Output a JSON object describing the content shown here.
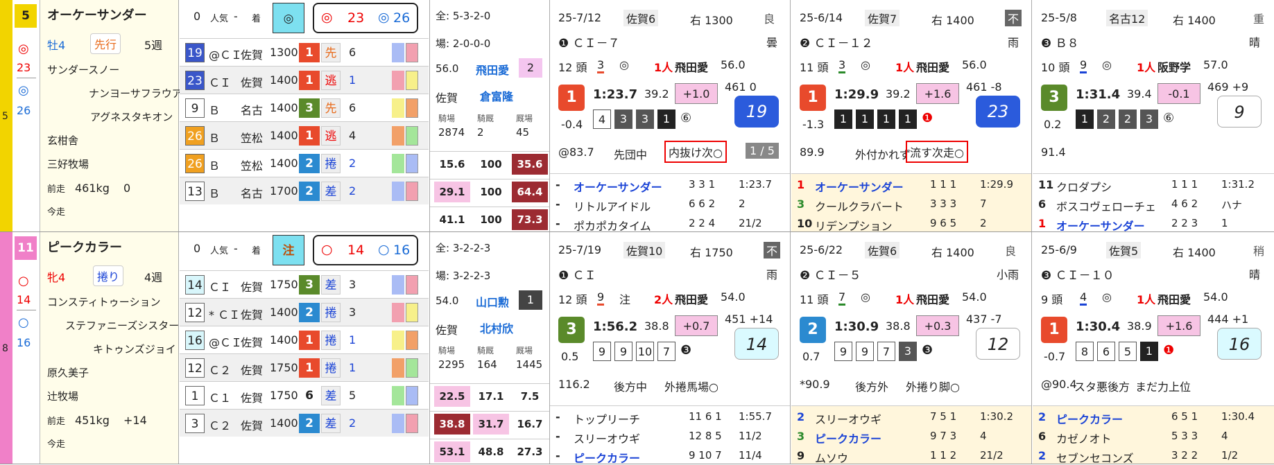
{
  "horses": [
    {
      "gate": "5",
      "num": "5",
      "gate_color": "#f2d400",
      "mark_top": "◎",
      "mark_top_value": "23",
      "mark_bottom": "◎",
      "mark_bottom_value": "26",
      "name": "オーケーサンダー",
      "sex_age": "牡4",
      "style": "先行",
      "interval": "5週",
      "sire": "サンダースノー",
      "dam": "ナンヨーサフラウア",
      "damsire": "アグネスタキオン",
      "owner": "玄柑舎",
      "breeder": "三好牧場",
      "prev_label": "前走",
      "weight": "461kg",
      "weight_diff": "0",
      "today_label": "今走",
      "odds_header": {
        "zero": "0",
        "ninki": "人気",
        "dash": "-",
        "chaku": "着",
        "mark": "◎",
        "mark1": "◎",
        "v1": "23",
        "mark2": "◎",
        "v2": "26"
      },
      "past": [
        {
          "rank": "19",
          "rank_color": "#3a56c9",
          "cls": "@ＣＩ",
          "track": "佐賀",
          "dist": "1300",
          "finish": "1",
          "fin_color": "#e84a2c",
          "style": "先",
          "fld": "6"
        },
        {
          "rank": "23",
          "rank_color": "#3a56c9",
          "cls": "ＣＩ",
          "track": "佐賀",
          "dist": "1400",
          "finish": "1",
          "fin_color": "#e84a2c",
          "style": "逃",
          "fld": "1"
        },
        {
          "rank": "9",
          "rank_color": "#ffffff",
          "cls": "Ｂ",
          "track": "名古",
          "dist": "1400",
          "finish": "3",
          "fin_color": "#5a8a2a",
          "style": "先",
          "fld": "6"
        },
        {
          "rank": "26",
          "rank_color": "#f0a020",
          "cls": "Ｂ",
          "track": "笠松",
          "dist": "1400",
          "finish": "1",
          "fin_color": "#e84a2c",
          "style": "逃",
          "fld": "4"
        },
        {
          "rank": "26",
          "rank_color": "#f0a020",
          "cls": "Ｂ",
          "track": "笠松",
          "dist": "1400",
          "finish": "2",
          "fin_color": "#2b8ad0",
          "style": "捲",
          "fld": "2"
        },
        {
          "rank": "13",
          "rank_color": "#ffffff",
          "cls": "Ｂ",
          "track": "名古",
          "dist": "1700",
          "finish": "2",
          "fin_color": "#2b8ad0",
          "style": "差",
          "fld": "2"
        }
      ],
      "stats": {
        "all": "全: 5-3-2-0",
        "course": "場: 2-0-0-0",
        "jockey_weight": "56.0",
        "jockey": "飛田愛",
        "jockey_num": "2",
        "trainer_loc": "佐賀",
        "trainer": "倉富隆",
        "head": [
          "騎場",
          "騎厩",
          "厩場"
        ],
        "counts": [
          "2874",
          "2",
          "45"
        ],
        "rows": [
          [
            "15.6",
            "100",
            "35.6"
          ],
          [
            "29.1",
            "100",
            "64.4"
          ],
          [
            "41.1",
            "100",
            "73.3"
          ]
        ]
      },
      "races": [
        {
          "date": "25-7/12",
          "track": "佐賀6",
          "dist": "右 1300",
          "cond": "良",
          "weather": "曇",
          "cls": "❶ ＣＩ－７",
          "heads": "12 頭",
          "num": "3",
          "mark": "◎",
          "ninki": "1人",
          "jockey": "飛田愛",
          "jw": "56.0",
          "finish": "1",
          "fin_color": "#e84a2c",
          "time": "1:23.7",
          "last": "39.2",
          "diff": "+1.0",
          "bw": "461 0",
          "idx": "19",
          "idx_style": "blue",
          "margin": "-0.4",
          "pos": [
            "4",
            "3",
            "3",
            "1"
          ],
          "pos_end": "⑥",
          "pace": "@83.7",
          "note1": "先団中",
          "note2": "内抜け次○",
          "box_note": "1 / 5",
          "res": [
            [
              "-",
              "オーケーサンダー",
              "3 3 1",
              "1:23.7"
            ],
            [
              "-",
              "リトルアイドル",
              "6 6 2",
              "2"
            ],
            [
              "-",
              "ポカポカタイム",
              "2 2 4",
              "21/2"
            ]
          ]
        },
        {
          "date": "25-6/14",
          "track": "佐賀7",
          "dist": "右 1400",
          "cond": "不",
          "weather": "雨",
          "cls": "❷ ＣＩ－１２",
          "heads": "11 頭",
          "num": "3",
          "mark": "◎",
          "ninki": "1人",
          "jockey": "飛田愛",
          "jw": "56.0",
          "finish": "1",
          "fin_color": "#e84a2c",
          "time": "1:29.9",
          "last": "39.2",
          "diff": "+1.6",
          "bw": "461 -8",
          "idx": "23",
          "idx_style": "blue",
          "margin": "-1.3",
          "pos": [
            "1",
            "1",
            "1",
            "1"
          ],
          "pos_end": "❶",
          "pace": "89.9",
          "note1": "外付かれず",
          "note2": "流す次走○",
          "box_note": "",
          "res": [
            [
              "1",
              "オーケーサンダー",
              "1 1 1",
              "1:29.9"
            ],
            [
              "3",
              "クールクラバート",
              "3 3 3",
              "7"
            ],
            [
              "10",
              "リデンプション",
              "9 6 5",
              "2"
            ]
          ]
        },
        {
          "date": "25-5/8",
          "track": "名古12",
          "dist": "右 1400",
          "cond": "重",
          "weather": "晴",
          "cls": "❸ Ｂ８",
          "heads": "10 頭",
          "num": "9",
          "mark": "◎",
          "ninki": "1人",
          "jockey": "阪野学",
          "jw": "57.0",
          "finish": "3",
          "fin_color": "#5a8a2a",
          "time": "1:31.4",
          "last": "39.4",
          "diff": "-0.1",
          "bw": "469 +9",
          "idx": "9",
          "idx_style": "white",
          "margin": "0.2",
          "pos": [
            "1",
            "2",
            "2",
            "3"
          ],
          "pos_end": "⑥",
          "pace": "91.4",
          "note1": "",
          "note2": "",
          "box_note": "",
          "res": [
            [
              "11",
              "クロダプシ",
              "1 1 1",
              "1:31.2"
            ],
            [
              "6",
              "ボスコヴェローチェ",
              "4 6 2",
              "ハナ"
            ],
            [
              "1",
              "オーケーサンダー",
              "2 2 3",
              "1"
            ]
          ]
        }
      ]
    },
    {
      "gate": "8",
      "num": "11",
      "gate_color": "#f080c8",
      "mark_top": "○",
      "mark_top_value": "14",
      "mark_bottom": "○",
      "mark_bottom_value": "16",
      "name": "ピークカラー",
      "sex_age": "牝4",
      "style": "捲り",
      "interval": "4週",
      "sire": "コンスティトゥーション",
      "dam": "ステファニーズシスター",
      "damsire": "キトゥンズジョイ",
      "owner": "原久美子",
      "breeder": "辻牧場",
      "prev_label": "前走",
      "weight": "451kg",
      "weight_diff": "+14",
      "today_label": "今走",
      "odds_header": {
        "zero": "0",
        "ninki": "人気",
        "dash": "-",
        "chaku": "着",
        "mark": "注",
        "mark1": "○",
        "v1": "14",
        "mark2": "○",
        "v2": "16"
      },
      "past": [
        {
          "rank": "14",
          "rank_color": "#d8f6fb",
          "cls": "ＣＩ",
          "track": "佐賀",
          "dist": "1750",
          "finish": "3",
          "fin_color": "#5a8a2a",
          "style": "差",
          "fld": "3"
        },
        {
          "rank": "12",
          "rank_color": "#ffffff",
          "cls": "* ＣＩ",
          "track": "佐賀",
          "dist": "1400",
          "finish": "2",
          "fin_color": "#2b8ad0",
          "style": "捲",
          "fld": "3"
        },
        {
          "rank": "16",
          "rank_color": "#d8f6fb",
          "cls": "@ＣＩ",
          "track": "佐賀",
          "dist": "1400",
          "finish": "1",
          "fin_color": "#e84a2c",
          "style": "捲",
          "fld": "1"
        },
        {
          "rank": "12",
          "rank_color": "#ffffff",
          "cls": "Ｃ２",
          "track": "佐賀",
          "dist": "1750",
          "finish": "1",
          "fin_color": "#e84a2c",
          "style": "捲",
          "fld": "1"
        },
        {
          "rank": "1",
          "rank_color": "#ffffff",
          "cls": "Ｃ１",
          "track": "佐賀",
          "dist": "1750",
          "finish": "6",
          "fin_color": "#ffffff",
          "style": "差",
          "fld": "5"
        },
        {
          "rank": "3",
          "rank_color": "#ffffff",
          "cls": "Ｃ２",
          "track": "佐賀",
          "dist": "1400",
          "finish": "2",
          "fin_color": "#2b8ad0",
          "style": "差",
          "fld": "2"
        }
      ],
      "stats": {
        "all": "全: 3-2-2-3",
        "course": "場: 3-2-2-3",
        "jockey_weight": "54.0",
        "jockey": "山口勲",
        "jockey_num": "1",
        "trainer_loc": "佐賀",
        "trainer": "北村欣",
        "head": [
          "騎場",
          "騎厩",
          "厩場"
        ],
        "counts": [
          "2295",
          "164",
          "1445"
        ],
        "rows": [
          [
            "22.5",
            "17.1",
            "7.5"
          ],
          [
            "38.8",
            "31.7",
            "16.7"
          ],
          [
            "53.1",
            "48.8",
            "27.3"
          ]
        ]
      },
      "races": [
        {
          "date": "25-7/19",
          "track": "佐賀10",
          "dist": "右 1750",
          "cond": "不",
          "weather": "雨",
          "cls": "❶ ＣＩ",
          "heads": "12 頭",
          "num": "9",
          "mark": "注",
          "ninki": "2人",
          "jockey": "飛田愛",
          "jw": "54.0",
          "finish": "3",
          "fin_color": "#5a8a2a",
          "time": "1:56.2",
          "last": "38.8",
          "diff": "+0.7",
          "bw": "451 +14",
          "idx": "14",
          "idx_style": "cyan",
          "margin": "0.5",
          "pos": [
            "9",
            "9",
            "10",
            "7"
          ],
          "pos_end": "❸",
          "pace": "116.2",
          "note1": "後方中",
          "note2": "外捲馬場○",
          "box_note": "",
          "res": [
            [
              "-",
              "トップリーチ",
              "11 6 1",
              "1:55.7"
            ],
            [
              "-",
              "スリーオウギ",
              "12 8 5",
              "11/2"
            ],
            [
              "-",
              "ピークカラー",
              "9 10 7",
              "11/4"
            ]
          ]
        },
        {
          "date": "25-6/22",
          "track": "佐賀6",
          "dist": "右 1400",
          "cond": "良",
          "weather": "小雨",
          "cls": "❷ ＣＩ－５",
          "heads": "11 頭",
          "num": "7",
          "mark": "◎",
          "ninki": "1人",
          "jockey": "飛田愛",
          "jw": "54.0",
          "finish": "2",
          "fin_color": "#2b8ad0",
          "time": "1:30.9",
          "last": "38.8",
          "diff": "+0.3",
          "bw": "437 -7",
          "idx": "12",
          "idx_style": "white",
          "margin": "0.7",
          "pos": [
            "9",
            "9",
            "7",
            "3"
          ],
          "pos_end": "❸",
          "pace": "*90.9",
          "note1": "後方外",
          "note2": "外捲り脚○",
          "box_note": "",
          "res": [
            [
              "2",
              "スリーオウギ",
              "7 5 1",
              "1:30.2"
            ],
            [
              "3",
              "ピークカラー",
              "9 7 3",
              "4"
            ],
            [
              "9",
              "ムソウ",
              "1 1 2",
              "21/2"
            ]
          ]
        },
        {
          "date": "25-6/9",
          "track": "佐賀5",
          "dist": "右 1400",
          "cond": "稍",
          "weather": "晴",
          "cls": "❸ ＣＩ－１０",
          "heads": "9 頭",
          "num": "4",
          "mark": "◎",
          "ninki": "1人",
          "jockey": "飛田愛",
          "jw": "54.0",
          "finish": "1",
          "fin_color": "#e84a2c",
          "time": "1:30.4",
          "last": "38.9",
          "diff": "+1.6",
          "bw": "444 +1",
          "idx": "16",
          "idx_style": "cyan",
          "margin": "-0.7",
          "pos": [
            "8",
            "6",
            "5",
            "1"
          ],
          "pos_end": "❶",
          "pace": "@90.4",
          "note1": "スタ悪後方",
          "note2": "まだ力上位",
          "box_note": "",
          "res": [
            [
              "2",
              "ピークカラー",
              "6 5 1",
              "1:30.4"
            ],
            [
              "6",
              "カゼノオト",
              "5 3 3",
              "4"
            ],
            [
              "2",
              "セブンセコンズ",
              "3 2 2",
              "1/2"
            ]
          ]
        }
      ]
    }
  ]
}
